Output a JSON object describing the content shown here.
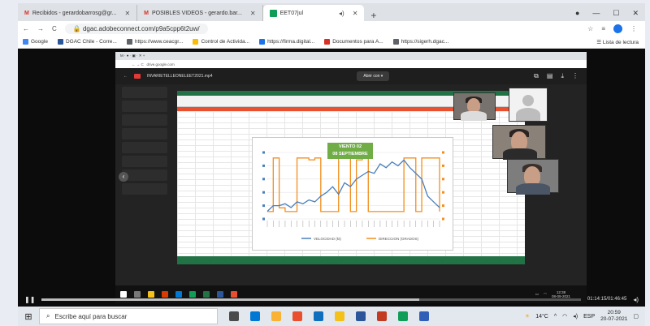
{
  "outer_tabs": [
    {
      "label": "Recibidos - gerardobarrosg@gr..."
    },
    {
      "label": "POSIBLES VIDEOS - gerardo.bar..."
    },
    {
      "label": "EET07jul"
    }
  ],
  "address": {
    "url": "dgac.adobeconnect.com/p9a5cpp6t2uw/"
  },
  "bookmarks": [
    {
      "label": "Google",
      "color": "#4285f4"
    },
    {
      "label": "DGAC Chile - Corre...",
      "color": "#2b579a"
    },
    {
      "label": "https://www.ceacgr...",
      "color": "#5f6368"
    },
    {
      "label": "Control de Activida...",
      "color": "#fbbc04"
    },
    {
      "label": "https://firma.digital...",
      "color": "#1a73e8"
    },
    {
      "label": "Documentos para A...",
      "color": "#d93025"
    },
    {
      "label": "https://sigerh.dgac...",
      "color": "#5f6368"
    }
  ],
  "reading_list": "Lista de lectura",
  "inner_browser": {
    "file_name": "INVARIETELLEONELEET2021.mp4",
    "open_with": "Abrir con"
  },
  "chart_data": {
    "type": "line",
    "title": "VIENTO 02\n08 SEPTIEMBRE",
    "x_count": 30,
    "series": [
      {
        "name": "VELOCIDAD (kt)",
        "color": "#4a7ebb",
        "values": [
          4,
          7,
          7,
          8,
          6,
          9,
          8,
          10,
          9,
          12,
          14,
          17,
          13,
          19,
          17,
          21,
          23,
          25,
          24,
          29,
          27,
          30,
          28,
          31,
          27,
          24,
          21,
          12,
          9,
          6
        ]
      },
      {
        "name": "DIRECCION (GRADOS)",
        "color": "#f28e1e",
        "values": [
          40,
          330,
          60,
          40,
          40,
          330,
          330,
          320,
          330,
          40,
          40,
          40,
          330,
          330,
          40,
          320,
          330,
          40,
          40,
          40,
          40,
          40,
          40,
          330,
          330,
          40,
          330,
          330,
          330,
          40
        ]
      }
    ],
    "y_left": [
      0,
      35
    ],
    "y_right": [
      0,
      360
    ]
  },
  "player": {
    "time": "01:14:15/01:46:45",
    "progress": 0.7
  },
  "inner_tray": {
    "time": "12:38",
    "date": "08-09-2021"
  },
  "taskbar": {
    "search_placeholder": "Escribe aquí para buscar",
    "weather": "14°C",
    "lang": "ESP",
    "time": "20:59",
    "date": "20-07-2021",
    "app_colors": [
      "#4b4b4b",
      "#0078d4",
      "#f9b233",
      "#e94f2f",
      "#0e6fbd",
      "#f3c11a",
      "#2b579a",
      "#c23b22",
      "#0f9d58",
      "#2f5fb7"
    ]
  }
}
